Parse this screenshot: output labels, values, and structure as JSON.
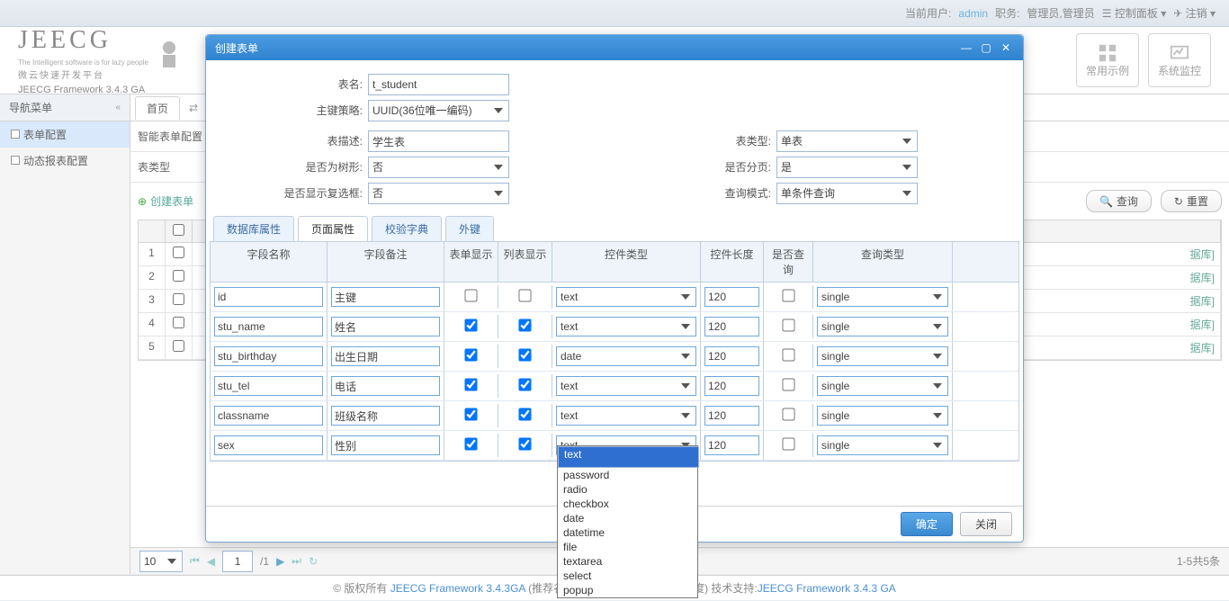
{
  "topbar": {
    "current_user_label": "当前用户:",
    "user": "admin",
    "role_label": "职务:",
    "role": "管理员,管理员",
    "control_panel": "控制面板",
    "logout": "注销"
  },
  "logo": {
    "title": "JEECG",
    "tag": "The Intelligent software is for lazy people",
    "sub": "微云快速开发平台",
    "version": "JEECG Framework 3.4.3 GA"
  },
  "tiles": {
    "examples": "常用示例",
    "monitor": "系统监控"
  },
  "sidebar": {
    "title": "导航菜单",
    "items": [
      "表单配置",
      "动态报表配置"
    ]
  },
  "tabs": [
    "首页"
  ],
  "page": {
    "config_tab": "智能表单配置",
    "table_type_label": "表类型",
    "create_btn": "创建表单",
    "search": "查询",
    "reset": "重置"
  },
  "grid": {
    "rows": [
      1,
      2,
      3,
      4,
      5
    ]
  },
  "pager": {
    "size": "10",
    "page": "1",
    "total_pages": "/1",
    "summary": "1-5共5条"
  },
  "footer": {
    "copyright": "© 版权所有 ",
    "product": "JEECG Framework 3.4.3GA",
    "note": " (推荐谷歌浏览器，获得更快响应速度) 技术支持:",
    "support": "JEECG Framework 3.4.3 GA"
  },
  "modal": {
    "title": "创建表单",
    "labels": {
      "table_name": "表名:",
      "pk_strategy": "主键策略:",
      "desc": "表描述:",
      "table_type": "表类型:",
      "is_tree": "是否为树形:",
      "is_page": "是否分页:",
      "show_checkbox": "是否显示复选框:",
      "query_mode": "查询模式:"
    },
    "values": {
      "table_name": "t_student",
      "pk_strategy": "UUID(36位唯一编码)",
      "desc": "学生表",
      "table_type": "单表",
      "is_tree": "否",
      "is_page": "是",
      "show_checkbox": "否",
      "query_mode": "单条件查询"
    },
    "sub_tabs": [
      "数据库属性",
      "页面属性",
      "校验字典",
      "外键"
    ],
    "cols": {
      "name": "字段名称",
      "remark": "字段备注",
      "form_show": "表单显示",
      "list_show": "列表显示",
      "ctl_type": "控件类型",
      "ctl_len": "控件长度",
      "is_query": "是否查询",
      "query_type": "查询类型"
    },
    "rows": [
      {
        "name": "id",
        "remark": "主键",
        "fs": false,
        "ls": false,
        "ct": "text",
        "len": "120",
        "q": false,
        "qt": "single"
      },
      {
        "name": "stu_name",
        "remark": "姓名",
        "fs": true,
        "ls": true,
        "ct": "text",
        "len": "120",
        "q": false,
        "qt": "single"
      },
      {
        "name": "stu_birthday",
        "remark": "出生日期",
        "fs": true,
        "ls": true,
        "ct": "date",
        "len": "120",
        "q": false,
        "qt": "single"
      },
      {
        "name": "stu_tel",
        "remark": "电话",
        "fs": true,
        "ls": true,
        "ct": "text",
        "len": "120",
        "q": false,
        "qt": "single"
      },
      {
        "name": "classname",
        "remark": "班级名称",
        "fs": true,
        "ls": true,
        "ct": "text",
        "len": "120",
        "q": false,
        "qt": "single"
      },
      {
        "name": "sex",
        "remark": "性别",
        "fs": true,
        "ls": true,
        "ct": "text",
        "len": "120",
        "q": false,
        "qt": "single"
      }
    ],
    "dropdown": [
      "text",
      "password",
      "radio",
      "checkbox",
      "date",
      "datetime",
      "file",
      "textarea",
      "select",
      "popup"
    ],
    "ok": "确定",
    "close": "关闭"
  },
  "bg_text": {
    "item": "据库]"
  }
}
